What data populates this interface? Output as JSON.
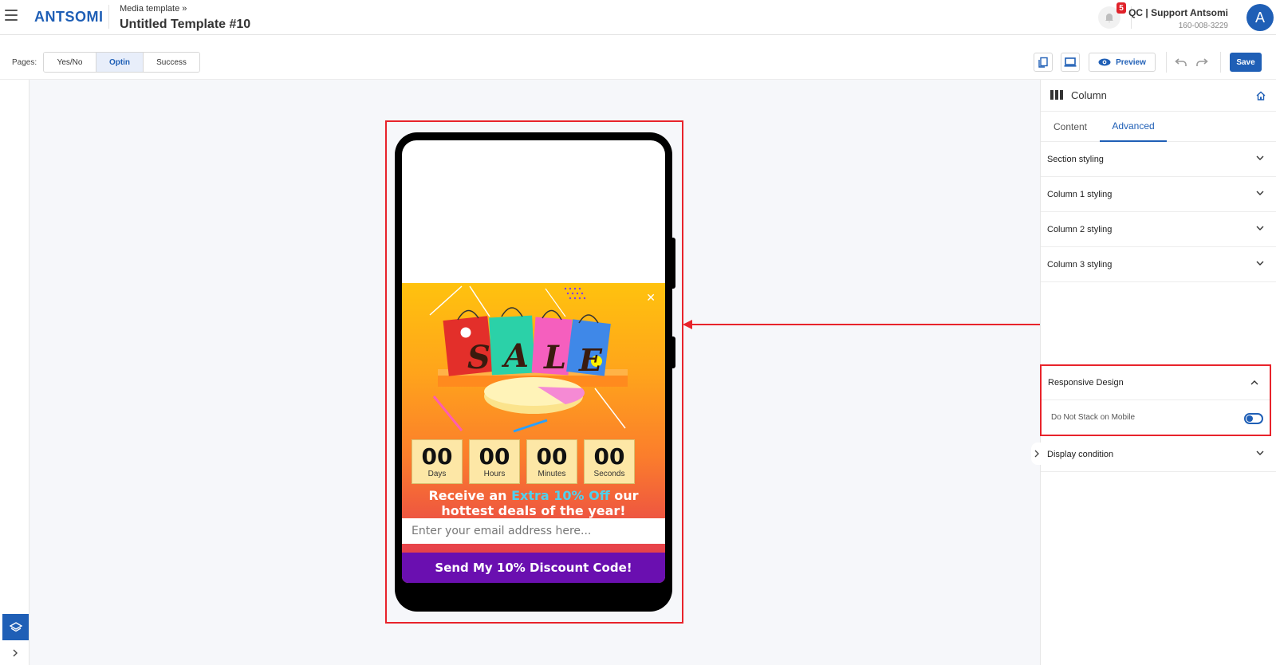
{
  "header": {
    "logo_text": "ANTSOMI",
    "breadcrumb": "Media template »",
    "title": "Untitled Template #10",
    "notification_count": "5",
    "account_name": "QC | Support Antsomi",
    "account_id": "160-008-3229",
    "avatar_initial": "A"
  },
  "toolbar": {
    "pages_label": "Pages:",
    "pages": [
      {
        "label": "Yes/No",
        "active": false
      },
      {
        "label": "Optin",
        "active": true
      },
      {
        "label": "Success",
        "active": false
      }
    ],
    "preview_label": "Preview",
    "save_label": "Save"
  },
  "popup": {
    "countdown": [
      {
        "value": "00",
        "label": "Days"
      },
      {
        "value": "00",
        "label": "Hours"
      },
      {
        "value": "00",
        "label": "Minutes"
      },
      {
        "value": "00",
        "label": "Seconds"
      }
    ],
    "headline_pre": "Receive an ",
    "headline_accent": "Extra 10% Off",
    "headline_post": " our hottest deals of the year!",
    "email_placeholder": "Enter your email address here...",
    "cta_label": "Send My 10% Discount Code!",
    "sale_letters": [
      "S",
      "A",
      "L",
      "E"
    ]
  },
  "panel": {
    "title": "Column",
    "tabs": [
      {
        "label": "Content",
        "active": false
      },
      {
        "label": "Advanced",
        "active": true
      }
    ],
    "sections": [
      {
        "label": "Section styling"
      },
      {
        "label": "Column 1 styling"
      },
      {
        "label": "Column 2 styling"
      },
      {
        "label": "Column 3 styling"
      }
    ],
    "responsive": {
      "label": "Responsive Design",
      "option_label": "Do Not Stack on Mobile",
      "option_on": true
    },
    "display_condition": "Display condition"
  },
  "colors": {
    "brand": "#1f5fb6",
    "highlight": "#e8232b",
    "cta": "#6a0fb0",
    "accent_text": "#4fd1ee"
  }
}
